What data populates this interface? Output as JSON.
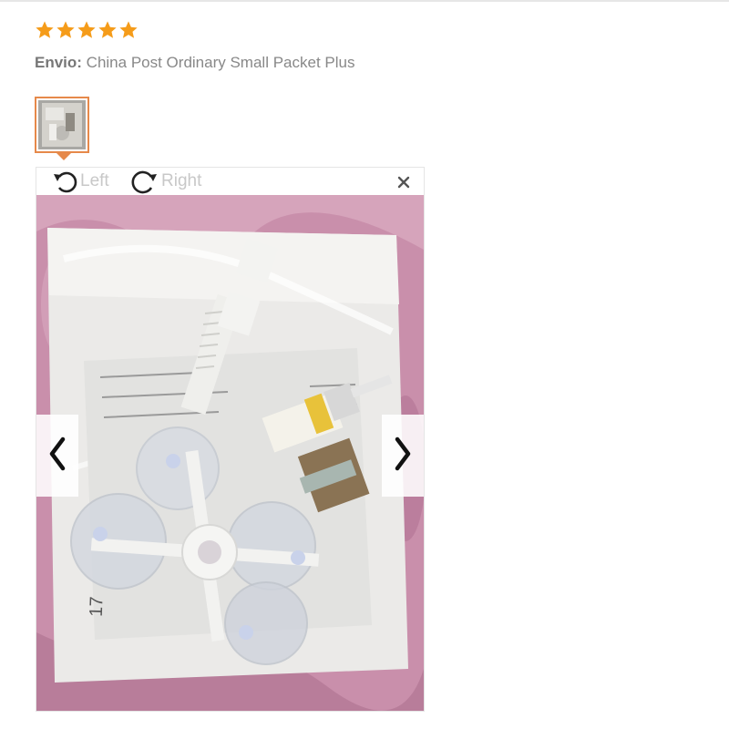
{
  "review": {
    "rating": 5,
    "rating_max": 5,
    "star_color": "#f59c1a",
    "shipping_label": "Envio:",
    "shipping_value": " China Post Ordinary Small Packet Plus"
  },
  "viewer": {
    "rotate_left_label": "Left",
    "rotate_right_label": "Right",
    "accent_color": "#e6894a",
    "icons": {
      "rotate_left": "rotate-left-icon",
      "rotate_right": "rotate-right-icon",
      "close": "close-icon",
      "prev": "chevron-left-icon",
      "next": "chevron-right-icon"
    }
  },
  "photo": {
    "package_label_number": "17"
  }
}
